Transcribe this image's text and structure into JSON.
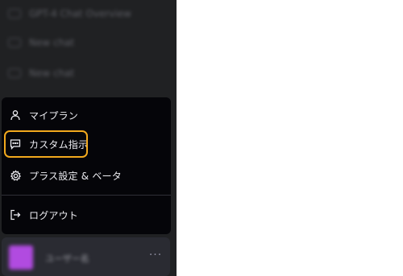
{
  "sidebar": {
    "history": [
      {
        "label": "GPT-4 Chat Overview"
      },
      {
        "label": "New chat"
      },
      {
        "label": "New chat"
      }
    ]
  },
  "menu": {
    "items": [
      {
        "label": "マイプラン",
        "icon": "user-icon"
      },
      {
        "label": "カスタム指示",
        "icon": "chat-bubble-icon"
      },
      {
        "label": "プラス設定 & ベータ",
        "icon": "gear-icon"
      },
      {
        "label": "ログアウト",
        "icon": "logout-icon"
      }
    ]
  },
  "profile": {
    "name": "ユーザー名",
    "more_label": "···"
  },
  "colors": {
    "sidebar_bg": "#202123",
    "menu_bg": "#050509",
    "highlight": "#f2a91d",
    "avatar": "#b14be0"
  }
}
